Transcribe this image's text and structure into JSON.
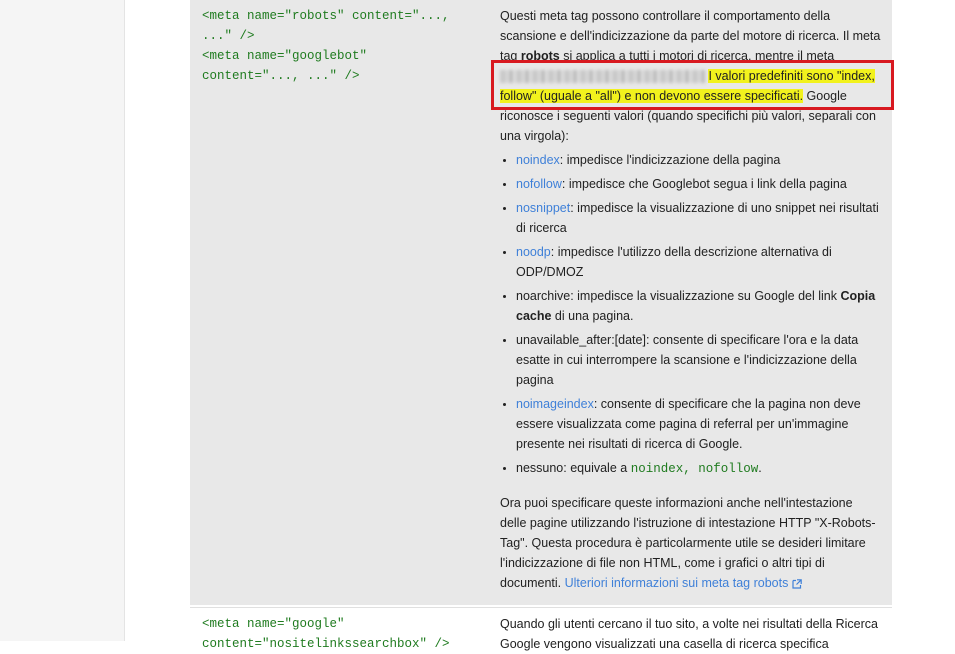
{
  "row1": {
    "code_lines": [
      "<meta name=\"robots\" content=\"...,",
      "...\" />",
      "<meta name=\"googlebot\"",
      "content=\"..., ...\" />"
    ],
    "intro": {
      "part1": "Questi meta tag possono controllare il comportamento della scansione e dell'indicizzazione da parte del motore di ricerca. Il meta tag ",
      "bold_robots": "robots",
      "part2": " si applica a tutti i motori di ricerca, mentre il meta",
      "highlighted": "I valori predefiniti sono \"index, follow\" (uguale a \"all\") e non devono essere specificati.",
      "part3": " Google riconosce i seguenti valori (quando specifichi più valori, separali con una virgola):"
    },
    "values": [
      {
        "term": "noindex",
        "link": true,
        "text": ": impedisce l'indicizzazione della pagina"
      },
      {
        "term": "nofollow",
        "link": true,
        "text": ": impedisce che Googlebot segua i link della pagina"
      },
      {
        "term": "nosnippet",
        "link": true,
        "text": ": impedisce la visualizzazione di uno snippet nei risultati di ricerca"
      },
      {
        "term": "noodp",
        "link": true,
        "text": ": impedisce l'utilizzo della descrizione alternativa di ODP/DMOZ"
      },
      {
        "term": "noarchive",
        "link": false,
        "text": ": impedisce la visualizzazione su Google del link ",
        "bold": "Copia cache",
        "tail": " di una pagina."
      },
      {
        "term": "unavailable_after:[date]",
        "link": false,
        "text": ": consente di specificare l'ora e la data esatte in cui interrompere la scansione e l'indicizzazione della pagina"
      },
      {
        "term": "noimageindex",
        "link": true,
        "text": ": consente di specificare che la pagina non deve essere visualizzata come pagina di referral per un'immagine presente nei risultati di ricerca di Google."
      },
      {
        "term": "nessuno",
        "link": false,
        "text": ": equivale a ",
        "mono": "noindex, nofollow",
        "tail": "."
      }
    ],
    "para2": "Ora puoi specificare queste informazioni anche nell'intestazione delle pagine utilizzando l'istruzione di intestazione HTTP \"X-Robots-Tag\". Questa procedura è particolarmente utile se desideri limitare l'indicizzazione di file non HTML, come i grafici o altri tipi di documenti. ",
    "more_link": "Ulteriori informazioni sui meta tag robots"
  },
  "row2": {
    "code_lines": [
      "<meta name=\"google\"",
      "content=\"nositelinkssearchbox\" />"
    ],
    "desc": "Quando gli utenti cercano il tuo sito, a volte nei risultati della Ricerca Google vengono visualizzati una casella di ricerca specifica"
  },
  "colors": {
    "highlight": "#f2f21d",
    "callout_border": "#d81920",
    "link": "#3f80d8",
    "code": "#1f7b1f"
  }
}
